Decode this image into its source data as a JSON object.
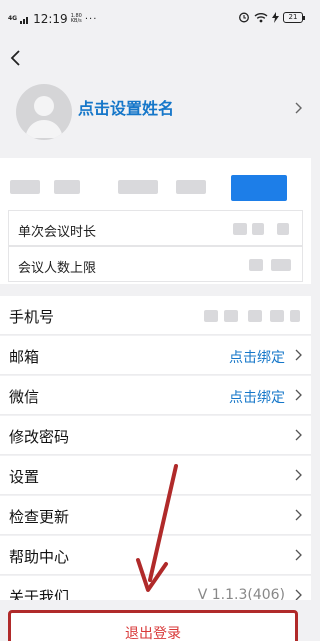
{
  "status_bar": {
    "signal_text": "4G",
    "time": "12:19",
    "speed_value": "1.80",
    "speed_unit": "KB/s",
    "more": "···",
    "battery": "21"
  },
  "profile": {
    "name_prompt": "点击设置姓名"
  },
  "meeting_card": {
    "duration_label": "单次会议时长",
    "participants_label": "会议人数上限"
  },
  "settings": {
    "phone_label": "手机号",
    "email_label": "邮箱",
    "email_value": "点击绑定",
    "wechat_label": "微信",
    "wechat_value": "点击绑定",
    "password_label": "修改密码",
    "settings_label": "设置",
    "update_label": "检查更新",
    "help_label": "帮助中心",
    "about_label": "关于我们",
    "about_value": "V 1.1.3(406)"
  },
  "logout": {
    "label": "退出登录"
  },
  "colors": {
    "accent": "#1677c9",
    "logout_text": "#d93a3a",
    "annotation": "#b02a2a"
  }
}
